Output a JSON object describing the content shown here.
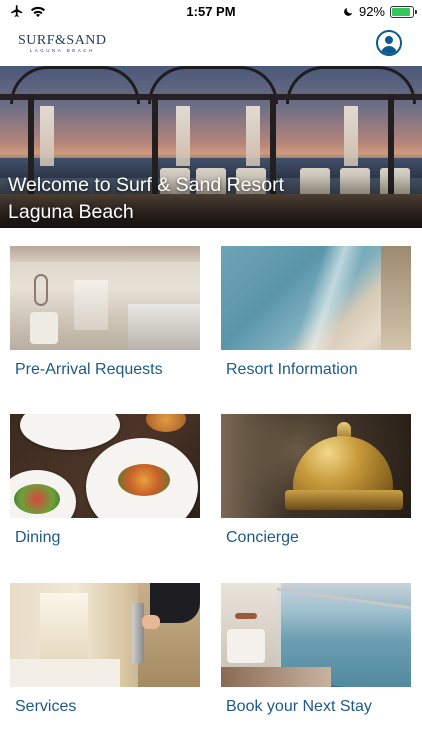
{
  "status_bar": {
    "time": "1:57 PM",
    "battery_percent": "92%",
    "battery_level": 0.92,
    "icons": [
      "airplane-icon",
      "wifi-icon",
      "moon-icon",
      "battery-charging-icon"
    ]
  },
  "header": {
    "logo_text": "SURF&SAND",
    "logo_subtext": "LAGUNA BEACH",
    "account_icon": "account-circle-icon"
  },
  "hero": {
    "title_line1": "Welcome to Surf & Sand Resort",
    "title_line2": "Laguna Beach"
  },
  "tiles": [
    {
      "label": "Pre-Arrival Requests"
    },
    {
      "label": "Resort Information"
    },
    {
      "label": "Dining"
    },
    {
      "label": "Concierge"
    },
    {
      "label": "Services"
    },
    {
      "label": "Book your Next Stay"
    }
  ],
  "colors": {
    "accent": "#1d5a86",
    "icon_blue": "#0e5a8f",
    "battery_green": "#34c759"
  }
}
